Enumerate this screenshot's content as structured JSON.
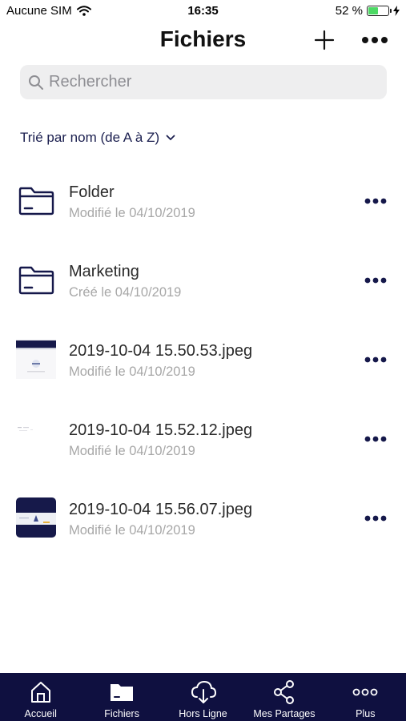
{
  "status_bar": {
    "carrier": "Aucune SIM",
    "time": "16:35",
    "battery_text": "52 %",
    "battery_level": 0.52,
    "battery_color": "#4cd964"
  },
  "header": {
    "title": "Fichiers",
    "add_icon": "plus-icon",
    "more_icon": "more-horizontal-icon"
  },
  "search": {
    "placeholder": "Rechercher",
    "value": ""
  },
  "sort": {
    "label": "Trié par nom (de A à Z)",
    "icon": "chevron-down-icon"
  },
  "files": [
    {
      "name": "Folder",
      "meta": "Modifié le 04/10/2019",
      "kind": "folder"
    },
    {
      "name": "Marketing",
      "meta": "Créé le 04/10/2019",
      "kind": "folder"
    },
    {
      "name": "2019-10-04 15.50.53.jpeg",
      "meta": "Modifié le 04/10/2019",
      "kind": "image"
    },
    {
      "name": "2019-10-04 15.52.12.jpeg",
      "meta": "Modifié le 04/10/2019",
      "kind": "image"
    },
    {
      "name": "2019-10-04 15.56.07.jpeg",
      "meta": "Modifié le 04/10/2019",
      "kind": "image"
    }
  ],
  "tab_bar": {
    "background": "#0f1040",
    "tabs": [
      {
        "label": "Accueil",
        "icon": "home-icon"
      },
      {
        "label": "Fichiers",
        "icon": "folder-icon",
        "active": true
      },
      {
        "label": "Hors Ligne",
        "icon": "cloud-download-icon"
      },
      {
        "label": "Mes Partages",
        "icon": "share-icon"
      },
      {
        "label": "Plus",
        "icon": "more-icon"
      }
    ]
  },
  "colors": {
    "accent": "#1b1f4f",
    "secondary_text": "#a7a7a7"
  }
}
